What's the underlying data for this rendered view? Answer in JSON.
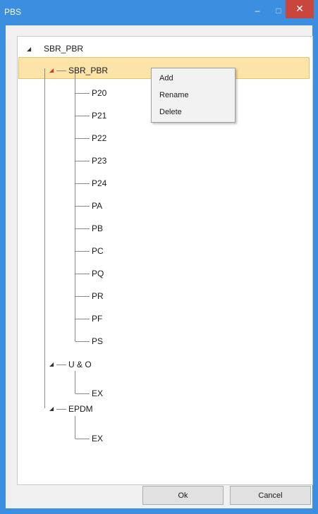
{
  "window": {
    "title": "PBS",
    "minimize": "–",
    "maximize": "□",
    "close": "✕"
  },
  "tree": {
    "root": {
      "label": "SBR_PBR",
      "expander": "◢"
    },
    "groups": [
      {
        "label": "SBR_PBR",
        "expander": "◢",
        "children": [
          "P20",
          "P21",
          "P22",
          "P23",
          "P24",
          "PA",
          "PB",
          "PC",
          "PQ",
          "PR",
          "PF",
          "PS"
        ]
      },
      {
        "label": "U & O",
        "expander": "◢",
        "children": [
          "EX"
        ]
      },
      {
        "label": "EPDM",
        "expander": "◢",
        "children": [
          "EX"
        ]
      }
    ]
  },
  "context_menu": {
    "items": [
      "Add",
      "Rename",
      "Delete"
    ]
  },
  "buttons": {
    "ok": "Ok",
    "cancel": "Cancel"
  },
  "colors": {
    "titlebar": "#3b8ee0",
    "close": "#c9463d",
    "selection": "#fce4a8",
    "expander_selected": "#d9342b"
  }
}
